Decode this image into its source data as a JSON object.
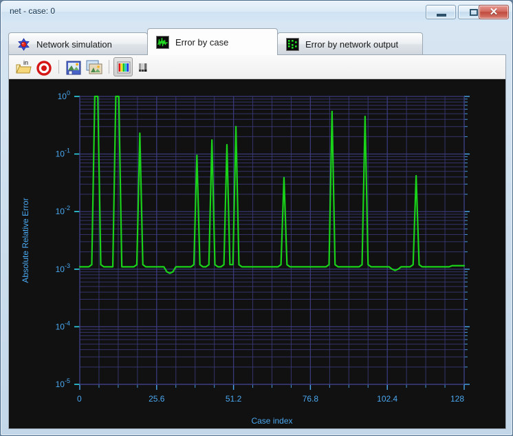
{
  "window": {
    "title": "net - case: 0",
    "buttons": {
      "minimize": "minimize-button",
      "maximize": "maximize-button",
      "close": "✕"
    }
  },
  "tabs": [
    {
      "label": "Network simulation",
      "icon": "network-node-icon",
      "active": false
    },
    {
      "label": "Error by case",
      "icon": "waveform-icon",
      "active": true
    },
    {
      "label": "Error by network output",
      "icon": "bar-matrix-icon",
      "active": false
    }
  ],
  "toolbar": {
    "items": [
      {
        "name": "open-folder-in-icon",
        "tooltip": "Open",
        "pressed": false
      },
      {
        "name": "record-target-icon",
        "tooltip": "Record",
        "pressed": false
      },
      {
        "name": "separator-1",
        "tooltip": "",
        "pressed": false
      },
      {
        "name": "save-image-icon",
        "tooltip": "Save image",
        "pressed": false
      },
      {
        "name": "copy-image-icon",
        "tooltip": "Copy image",
        "pressed": false
      },
      {
        "name": "separator-2",
        "tooltip": "",
        "pressed": false
      },
      {
        "name": "color-bars-icon",
        "tooltip": "Color",
        "pressed": true
      },
      {
        "name": "gray-bars-icon",
        "tooltip": "Grayscale",
        "pressed": false
      }
    ]
  },
  "chart_data": {
    "type": "line",
    "title": "",
    "xlabel": "Case index",
    "ylabel": "Absolute Relative Error",
    "xlim": [
      0,
      128
    ],
    "ylim": [
      1e-05,
      1.0
    ],
    "yscale": "log",
    "xscale": "linear",
    "grid": true,
    "grid_minor": true,
    "legend": "none",
    "series_color": "#19d219",
    "background": "#111112",
    "grid_color": "#3a3a7a",
    "axis_color": "#4aa8ef",
    "xticks": [
      0,
      25.6,
      51.2,
      76.8,
      102.4,
      128
    ],
    "xticklabels": [
      "0",
      "25.6",
      "51.2",
      "76.8",
      "102.4",
      "128"
    ],
    "yticks": [
      1,
      0.1,
      0.01,
      0.001,
      0.0001,
      1e-05
    ],
    "yticklabels": [
      "10⁰",
      "10⁻¹",
      "10⁻²",
      "10⁻³",
      "10⁻⁴",
      "10⁻⁵"
    ],
    "baseline": 0.0011,
    "series": [
      {
        "name": "Absolute Relative Error",
        "x": [
          0,
          1,
          2,
          3,
          4,
          5,
          6,
          7,
          8,
          9,
          10,
          11,
          12,
          13,
          14,
          15,
          16,
          17,
          18,
          19,
          20,
          21,
          22,
          23,
          24,
          25,
          26,
          27,
          28,
          29,
          30,
          31,
          32,
          33,
          34,
          35,
          36,
          37,
          38,
          39,
          40,
          41,
          42,
          43,
          44,
          45,
          46,
          47,
          48,
          49,
          50,
          51,
          52,
          53,
          54,
          55,
          56,
          57,
          58,
          59,
          60,
          61,
          62,
          63,
          64,
          65,
          66,
          67,
          68,
          69,
          70,
          71,
          72,
          73,
          74,
          75,
          76,
          77,
          78,
          79,
          80,
          81,
          82,
          83,
          84,
          85,
          86,
          87,
          88,
          89,
          90,
          91,
          92,
          93,
          94,
          95,
          96,
          97,
          98,
          99,
          100,
          101,
          102,
          103,
          104,
          105,
          106,
          107,
          108,
          109,
          110,
          111,
          112,
          113,
          114,
          115,
          116,
          117,
          118,
          119,
          120,
          121,
          122,
          123,
          124,
          125,
          126,
          127,
          128
        ],
        "y": [
          0.0011,
          0.0011,
          0.0011,
          0.0011,
          0.0012,
          1.0,
          1.0,
          0.0012,
          0.0011,
          0.0011,
          0.0011,
          0.0011,
          1.0,
          1.0,
          0.0011,
          0.0011,
          0.0011,
          0.0011,
          0.0011,
          0.0012,
          0.23,
          0.0012,
          0.0011,
          0.0011,
          0.0011,
          0.0011,
          0.0011,
          0.0011,
          0.0011,
          0.0009,
          0.00085,
          0.0009,
          0.0011,
          0.0011,
          0.0011,
          0.0011,
          0.0011,
          0.0011,
          0.0012,
          0.095,
          0.0012,
          0.0011,
          0.0011,
          0.0012,
          0.175,
          0.0012,
          0.0011,
          0.0011,
          0.0012,
          0.145,
          0.0012,
          0.0012,
          0.3,
          0.0012,
          0.0011,
          0.0011,
          0.0011,
          0.0011,
          0.0011,
          0.0011,
          0.0011,
          0.0011,
          0.0011,
          0.0011,
          0.0011,
          0.0011,
          0.0011,
          0.0012,
          0.039,
          0.0012,
          0.0011,
          0.0011,
          0.0011,
          0.0011,
          0.0011,
          0.0011,
          0.0011,
          0.0011,
          0.0011,
          0.0011,
          0.0011,
          0.0011,
          0.0011,
          0.0012,
          0.55,
          0.0012,
          0.0011,
          0.0011,
          0.0011,
          0.0011,
          0.0011,
          0.0011,
          0.0011,
          0.0011,
          0.0012,
          0.45,
          0.0012,
          0.0011,
          0.0011,
          0.0011,
          0.0011,
          0.0011,
          0.0011,
          0.0011,
          0.001,
          0.00095,
          0.001,
          0.0011,
          0.0011,
          0.0011,
          0.0011,
          0.0012,
          0.042,
          0.0012,
          0.0011,
          0.0011,
          0.0011,
          0.0011,
          0.0011,
          0.0011,
          0.0011,
          0.0011,
          0.0011,
          0.0011,
          0.00115,
          0.00115,
          0.00115,
          0.00115,
          0.00115
        ]
      }
    ],
    "peaks": [
      {
        "x": 5,
        "y": 1.0
      },
      {
        "x": 6,
        "y": 1.0
      },
      {
        "x": 12,
        "y": 1.0
      },
      {
        "x": 13,
        "y": 1.0
      },
      {
        "x": 20,
        "y": 0.23
      },
      {
        "x": 39,
        "y": 0.095
      },
      {
        "x": 44,
        "y": 0.175
      },
      {
        "x": 49,
        "y": 0.145
      },
      {
        "x": 52,
        "y": 0.3
      },
      {
        "x": 68,
        "y": 0.039
      },
      {
        "x": 84,
        "y": 0.55
      },
      {
        "x": 94,
        "y": 0.45
      },
      {
        "x": 110,
        "y": 0.042
      }
    ]
  }
}
